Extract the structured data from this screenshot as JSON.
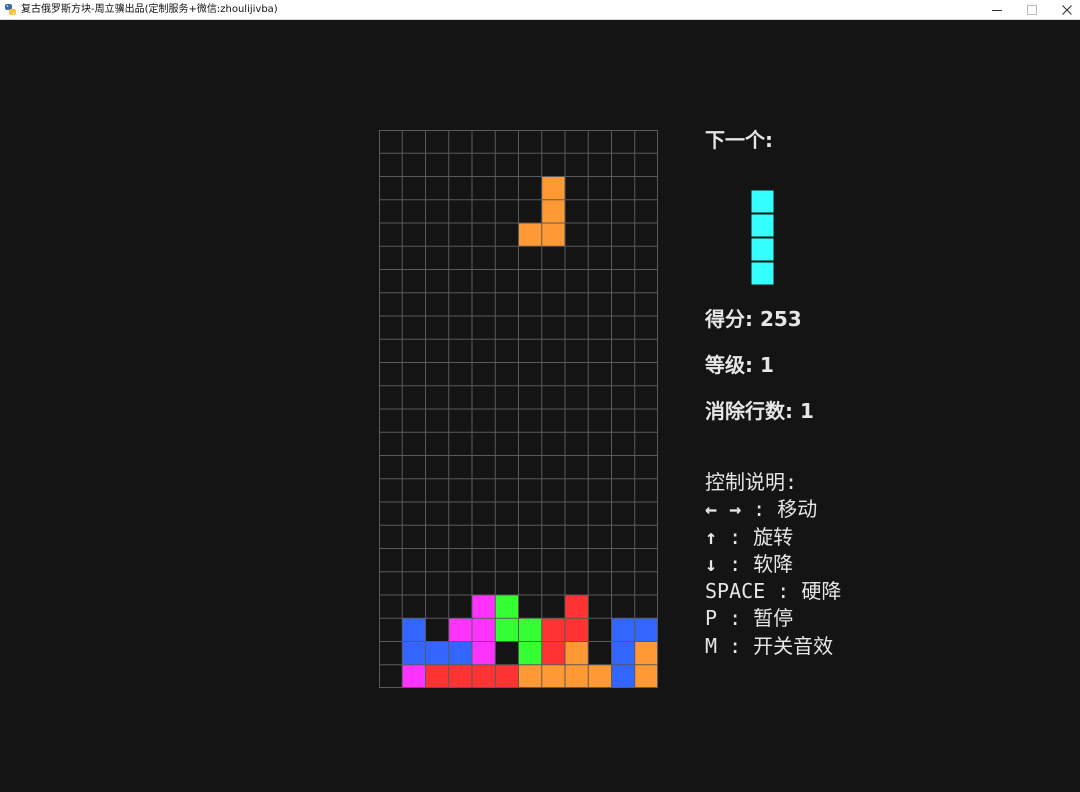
{
  "window": {
    "title": "复古俄罗斯方块-周立骥出品(定制服务+微信:zhoulijivba)",
    "controls": [
      "minimize-icon",
      "maximize-icon",
      "close-icon"
    ]
  },
  "board": {
    "columns": 12,
    "rows": 24,
    "background": "#141414",
    "grid_color": "#5a5a5a",
    "colors": {
      "O": "#ff9933",
      "R": "#ff3333",
      "B": "#3366ff",
      "M": "#ff33ff",
      "G": "#33ff33",
      "C": "#33ffff"
    },
    "active_piece": {
      "shape": "J",
      "color": "#ff9933",
      "cells": [
        [
          7,
          2
        ],
        [
          7,
          3
        ],
        [
          6,
          4
        ],
        [
          7,
          4
        ]
      ]
    },
    "stack": [
      ". . . . . . . . . . . .",
      ". . . . . . . . . . . .",
      ". . . . . . . . . . . .",
      ". . . . . . . . . . . .",
      ". . . . . . . . . . . .",
      ". . . . . . . . . . . .",
      ". . . . . . . . . . . .",
      ". . . . . . . . . . . .",
      ". . . . . . . . . . . .",
      ". . . . . . . . . . . .",
      ". . . . . . . . . . . .",
      ". . . . . . . . . . . .",
      ". . . . . . . . . . . .",
      ". . . . . . . . . . . .",
      ". . . . . . . . . . . .",
      ". . . . . . . . . . . .",
      ". . . . . . . . . . . .",
      ". . . . . . . . . . . .",
      ". . . . . . . . . . . .",
      ". . . . . . . . . . . .",
      ". . . . M G . . R . . .",
      ". B . M M G G R R . B B",
      ". B B B M . G R O . B O",
      ". M R R R R O O O O B O"
    ]
  },
  "next_piece": {
    "label": "下一个:",
    "shape": "I",
    "color": "#33ffff",
    "icon": "i-tetromino-icon"
  },
  "stats": {
    "score_label": "得分: ",
    "score": "253",
    "level_label": "等级: ",
    "level": "1",
    "lines_label": "消除行数: ",
    "lines": "1"
  },
  "controls": {
    "title": "控制说明:",
    "left_right_keys": "← →",
    "left_right_action": " : 移动",
    "up_key": "↑",
    "up_action": " : 旋转",
    "down_key": "↓",
    "down_action": " : 软降",
    "space_key": "SPACE",
    "space_action": " : 硬降",
    "pause_key": "P",
    "pause_action": " : 暂停",
    "mute_key": "M",
    "mute_action": " : 开关音效"
  }
}
